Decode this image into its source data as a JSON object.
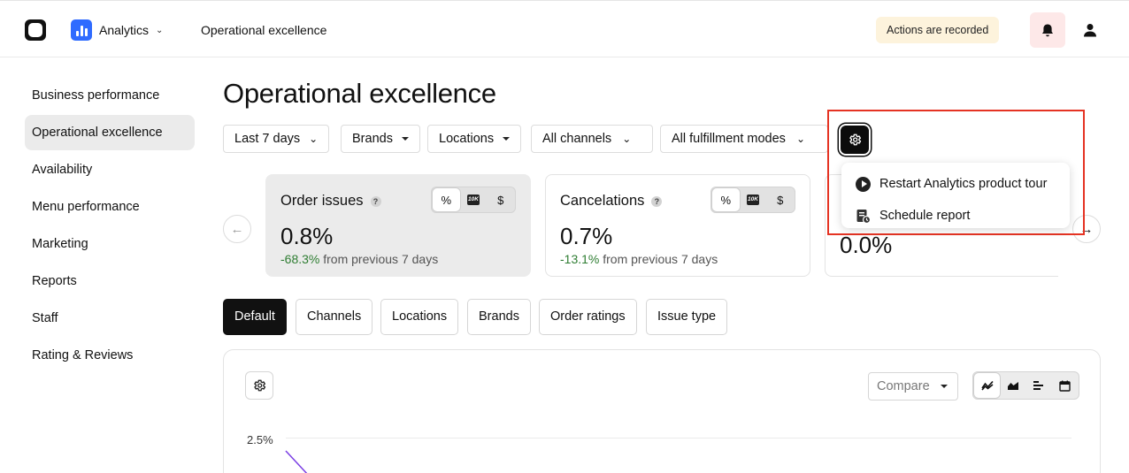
{
  "header": {
    "app_name": "Analytics",
    "breadcrumb": "Operational excellence",
    "recorded_badge": "Actions are recorded"
  },
  "sidebar": {
    "items": [
      {
        "label": "Business performance"
      },
      {
        "label": "Operational excellence",
        "active": true
      },
      {
        "label": "Availability"
      },
      {
        "label": "Menu performance"
      },
      {
        "label": "Marketing"
      },
      {
        "label": "Reports"
      },
      {
        "label": "Staff"
      },
      {
        "label": "Rating & Reviews"
      }
    ]
  },
  "page": {
    "title": "Operational excellence"
  },
  "filters": {
    "date_range": "Last 7 days",
    "brands": "Brands",
    "locations": "Locations",
    "channels": "All channels",
    "fulfillment": "All fulfillment modes"
  },
  "settings_menu": {
    "items": [
      {
        "label": "Restart Analytics product tour",
        "icon": "play-circle-icon"
      },
      {
        "label": "Schedule report",
        "icon": "schedule-report-icon"
      }
    ]
  },
  "metric_cards": [
    {
      "title": "Order issues",
      "value": "0.8%",
      "change": "-68.3%",
      "change_suffix": "from previous 7 days",
      "format_options": [
        "%",
        "10K",
        "$"
      ],
      "selected_format": "%"
    },
    {
      "title": "Cancelations",
      "value": "0.7%",
      "change": "-13.1%",
      "change_suffix": "from previous 7 days",
      "format_options": [
        "%",
        "10K",
        "$"
      ],
      "selected_format": "%"
    },
    {
      "value": "0.0%"
    }
  ],
  "view_tabs": [
    {
      "label": "Default",
      "active": true
    },
    {
      "label": "Channels"
    },
    {
      "label": "Locations"
    },
    {
      "label": "Brands"
    },
    {
      "label": "Order ratings"
    },
    {
      "label": "Issue type"
    }
  ],
  "chart_panel": {
    "compare_label": "Compare",
    "y_tick": "2.5%",
    "view_modes": [
      "line-chart-icon",
      "area-chart-icon",
      "bar-chart-icon",
      "calendar-icon"
    ],
    "selected_view": "line-chart-icon",
    "line_color": "#7b3fe4"
  },
  "colors": {
    "highlight": "#e53323",
    "positive_change": "#2e7d32",
    "badge_bg": "#fdf3dc",
    "brand_blue": "#2f6bff"
  }
}
